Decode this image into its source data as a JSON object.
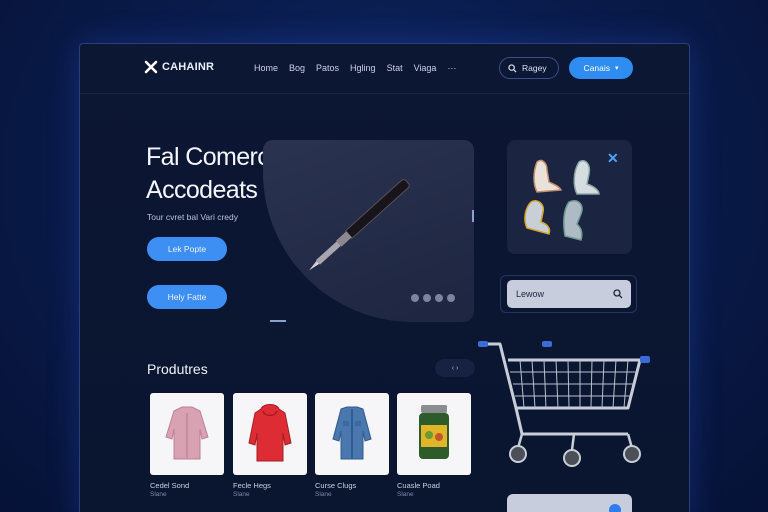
{
  "brand": {
    "name": "CAHAINR"
  },
  "nav": {
    "items": [
      "Home",
      "Bog",
      "Patos",
      "Hgling",
      "Stat",
      "Viaga"
    ],
    "more": "···"
  },
  "header": {
    "search_label": "Ragey",
    "cta_label": "Canais"
  },
  "hero": {
    "title_line1": "Fal Comerca",
    "title_line2": "Accodeats",
    "subtitle": "Tour cvret bal Vari credy",
    "button1": "Lek Popte",
    "button2": "Hely Fatte"
  },
  "side_search": {
    "value": "Lewow"
  },
  "products": {
    "title": "Produtres",
    "pager": "‹ ›",
    "items": [
      {
        "name": "Cedel Sond",
        "price": "Slane"
      },
      {
        "name": "Fecle Hegs",
        "price": "Slane"
      },
      {
        "name": "Curse Clugs",
        "price": "Slane"
      },
      {
        "name": "Cuasle Poad",
        "price": "Slane"
      }
    ]
  },
  "colors": {
    "accent": "#2f8cf0",
    "bg": "#0a1c4d",
    "panel": "#0c1733"
  }
}
